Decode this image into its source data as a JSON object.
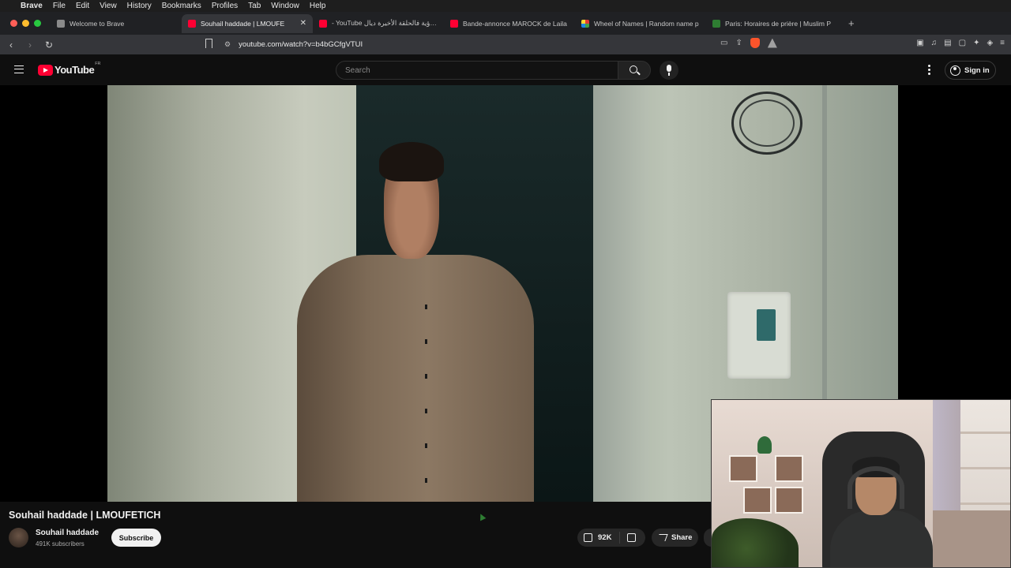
{
  "menubar": {
    "app": "Brave",
    "items": [
      "File",
      "Edit",
      "View",
      "History",
      "Bookmarks",
      "Profiles",
      "Tab",
      "Window",
      "Help"
    ]
  },
  "tabs": [
    {
      "label": "Welcome to Brave",
      "icon": "brave-icon",
      "active": false
    },
    {
      "label": "Souhail haddade | LMOUFE",
      "icon": "youtube-icon",
      "active": true
    },
    {
      "label": "- YouTube الرؤية فالحلقة الأخيرة ديال",
      "icon": "youtube-icon",
      "active": false
    },
    {
      "label": "Bande-annonce MAROCK de Laila",
      "icon": "youtube-icon",
      "active": false
    },
    {
      "label": "Wheel of Names | Random name p",
      "icon": "wheel-icon",
      "active": false
    },
    {
      "label": "Paris: Horaires de prière | Muslim P",
      "icon": "muslimpro-icon",
      "active": false
    }
  ],
  "address_bar": {
    "url": "youtube.com/watch?v=b4bGCfgVTUI"
  },
  "youtube": {
    "logo_text": "YouTube",
    "region": "FR",
    "search_placeholder": "Search",
    "sign_in": "Sign in"
  },
  "video": {
    "title": "Souhail haddade | LMOUFETICH",
    "channel": "Souhail haddade",
    "subscribers": "491K subscribers",
    "subscribe_label": "Subscribe",
    "likes": "92K",
    "share_label": "Share"
  },
  "colors": {
    "accent": "#ff0033",
    "background": "#0f0f0f",
    "pill": "#272727"
  }
}
